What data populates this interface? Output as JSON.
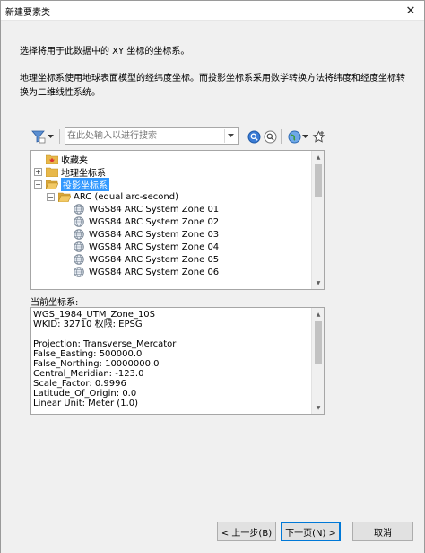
{
  "window": {
    "title": "新建要素类",
    "close_glyph": "✕"
  },
  "intro": {
    "line1": "选择将用于此数据中的 XY 坐标的坐标系。",
    "line2": "地理坐标系使用地球表面模型的经纬度坐标。而投影坐标系采用数学转换方法将纬度和经度坐标转换为二维线性系统。"
  },
  "toolbar": {
    "search_placeholder": "在此处输入以进行搜索",
    "icons": [
      "filter-icon",
      "search-icon",
      "search-advanced-icon",
      "globe-icon",
      "favorite-add-icon"
    ]
  },
  "tree": {
    "favorites": "收藏夹",
    "geographic": "地理坐标系",
    "projected": "投影坐标系",
    "arc_folder": "ARC (equal arc-second)",
    "items": [
      "WGS84 ARC System Zone 01",
      "WGS84 ARC System Zone 02",
      "WGS84 ARC System Zone 03",
      "WGS84 ARC System Zone 04",
      "WGS84 ARC System Zone 05",
      "WGS84 ARC System Zone 06"
    ]
  },
  "current": {
    "label": "当前坐标系:",
    "lines": [
      "WGS_1984_UTM_Zone_10S",
      "WKID: 32710 权限: EPSG",
      "",
      "Projection: Transverse_Mercator",
      "False_Easting: 500000.0",
      "False_Northing: 10000000.0",
      "Central_Meridian: -123.0",
      "Scale_Factor: 0.9996",
      "Latitude_Of_Origin: 0.0",
      "Linear Unit: Meter (1.0)"
    ]
  },
  "buttons": {
    "back": "< 上一步(B)",
    "next": "下一页(N) >",
    "cancel": "取消"
  },
  "colors": {
    "selection": "#3399ff",
    "primary_border": "#0078d7",
    "folder": "#e8b84a"
  }
}
